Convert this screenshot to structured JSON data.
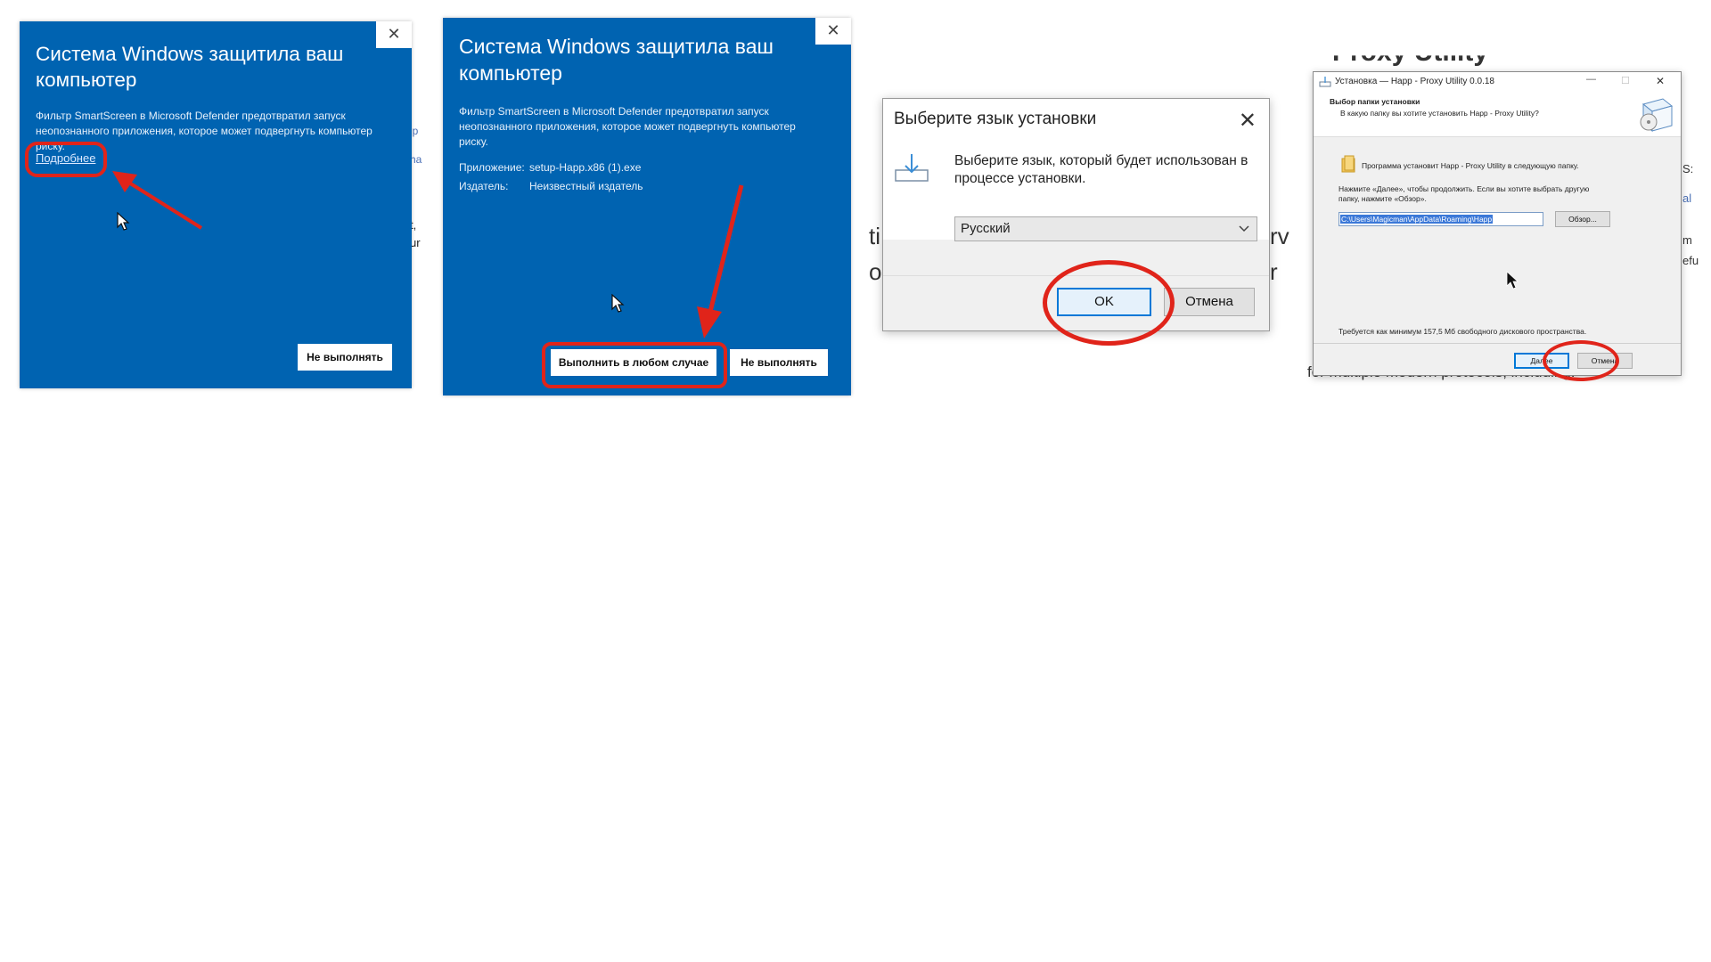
{
  "backdrop": {
    "frag1": "lp",
    "frag2": "ha",
    "frag3": "t,",
    "frag4": "ur",
    "frag5": "ti",
    "frag6": "rv",
    "frag7": "r",
    "frag8": "Proxy Utility",
    "frag9": "for multiple modern protocols, including:",
    "frag10": "op",
    "frag11": "S:",
    "frag12": "al",
    "frag13": "m",
    "frag14": "efu"
  },
  "panel1": {
    "title": "Система Windows защитила ваш компьютер",
    "description": "Фильтр SmartScreen в Microsoft Defender предотвратил запуск неопознанного приложения, которое может подвергнуть компьютер риску.",
    "more_link": "Подробнее",
    "dont_run_button": "Не выполнять",
    "close_glyph": "✕"
  },
  "panel2": {
    "title": "Система Windows защитила ваш компьютер",
    "description": "Фильтр SmartScreen в Microsoft Defender предотвратил запуск неопознанного приложения, которое может подвергнуть компьютер риску.",
    "app_label": "Приложение:",
    "app_value": "setup-Happ.x86 (1).exe",
    "publisher_label": "Издатель:",
    "publisher_value": "Неизвестный издатель",
    "run_anyway_button": "Выполнить в любом случае",
    "dont_run_button": "Не выполнять",
    "close_glyph": "✕"
  },
  "lang_dialog": {
    "title": "Выберите язык установки",
    "prompt": "Выберите язык, который будет использован в процессе установки.",
    "selected_language": "Русский",
    "ok_button": "OK",
    "cancel_button": "Отмена",
    "close_glyph": "✕"
  },
  "installer": {
    "window_title": "Установка — Happ - Proxy Utility 0.0.18",
    "section_title": "Выбор папки установки",
    "section_subtitle": "В какую папку вы хотите установить Happ - Proxy Utility?",
    "install_note": "Программа установит Happ - Proxy Utility в следующую папку.",
    "instructions": "Нажмите «Далее», чтобы продолжить. Если вы хотите выбрать другую папку, нажмите «Обзор».",
    "path_value": "C:\\Users\\Magicman\\AppData\\Roaming\\Happ",
    "browse_button": "Обзор...",
    "disk_space_note": "Требуется как минимум 157,5 Мб свободного дискового пространства.",
    "next_button": "Далее",
    "cancel_button": "Отмена",
    "minimize_glyph": "—",
    "maximize_glyph": "☐",
    "close_glyph": "✕"
  },
  "colors": {
    "smartscreen_blue": "#0063b1",
    "annotation_red": "#e0241a",
    "focus_blue": "#0078d7"
  }
}
